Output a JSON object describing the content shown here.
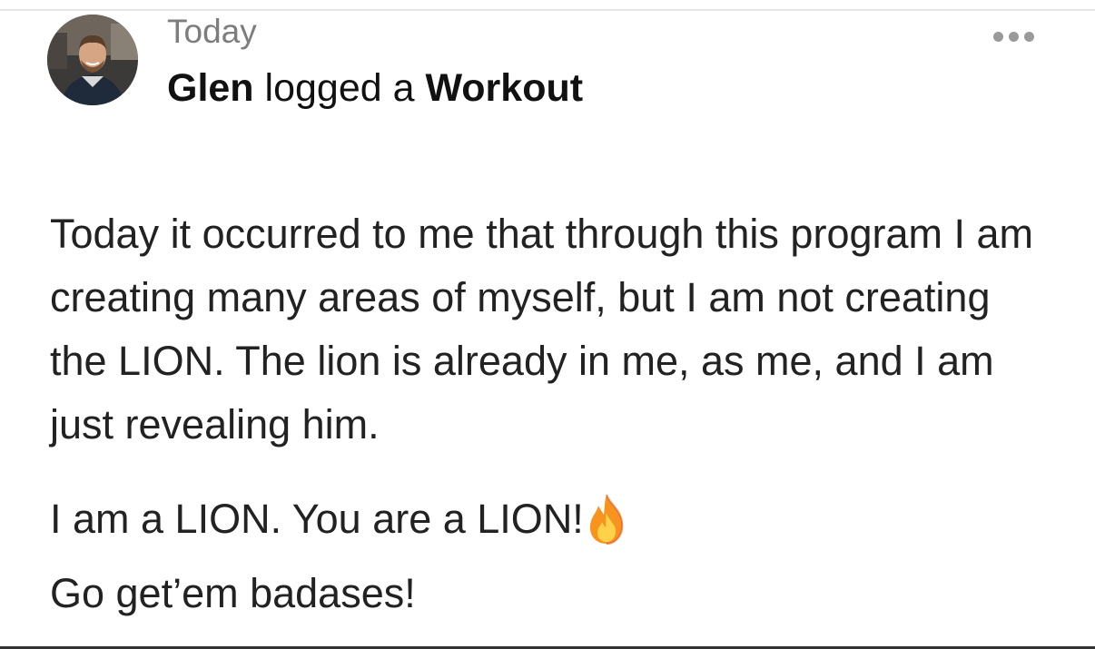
{
  "post": {
    "timestamp": "Today",
    "author": "Glen",
    "action": "logged a",
    "activity": "Workout",
    "more_icon": "ellipsis-horizontal-icon",
    "avatar_icon": "user-avatar-photo",
    "body": {
      "para1": "Today it occurred to me that through this program I am creating many areas of myself, but I am not creating the LION. The lion is already in me, as me, and I am just revealing him.",
      "para2": "I am a LION.  You are a LION!",
      "para2_emoji": "fire-icon",
      "para3": "Go get’em badases!"
    }
  },
  "colors": {
    "timestamp": "#7d7d7d",
    "text": "#222222",
    "dots": "#9a9a9a",
    "fire_outer": "#f7931e",
    "fire_inner": "#ffd24a"
  }
}
